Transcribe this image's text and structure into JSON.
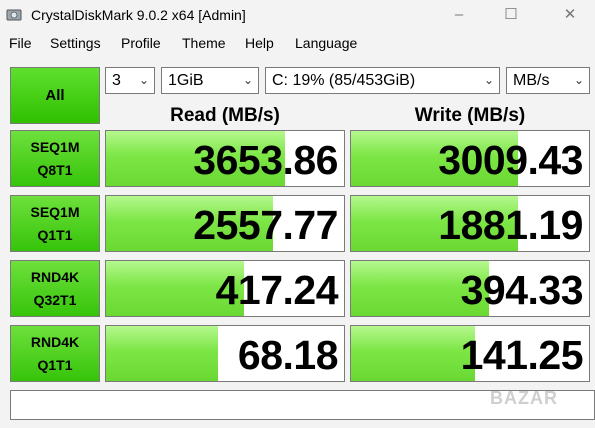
{
  "window": {
    "title": "CrystalDiskMark 9.0.2 x64 [Admin]"
  },
  "menu": [
    "File",
    "Settings",
    "Profile",
    "Theme",
    "Help",
    "Language"
  ],
  "controls": {
    "all_label": "All",
    "count": "3",
    "size": "1GiB",
    "drive": "C: 19% (85/453GiB)",
    "unit": "MB/s"
  },
  "headers": {
    "read": "Read (MB/s)",
    "write": "Write (MB/s)"
  },
  "rows": [
    {
      "line1": "SEQ1M",
      "line2": "Q8T1",
      "read": "3653.86",
      "write": "3009.43"
    },
    {
      "line1": "SEQ1M",
      "line2": "Q1T1",
      "read": "2557.77",
      "write": "1881.19"
    },
    {
      "line1": "RND4K",
      "line2": "Q32T1",
      "read": "417.24",
      "write": "394.33"
    },
    {
      "line1": "RND4K",
      "line2": "Q1T1",
      "read": "68.18",
      "write": "141.25"
    }
  ],
  "bar_fraction": [
    {
      "read": 0.75,
      "write": 0.7
    },
    {
      "read": 0.7,
      "write": 0.7
    },
    {
      "read": 0.58,
      "write": 0.58
    },
    {
      "read": 0.47,
      "write": 0.52
    }
  ],
  "watermark": "BAZAR",
  "colors": {
    "accent_green": "#2fc000",
    "bar_green": "#7de646"
  }
}
